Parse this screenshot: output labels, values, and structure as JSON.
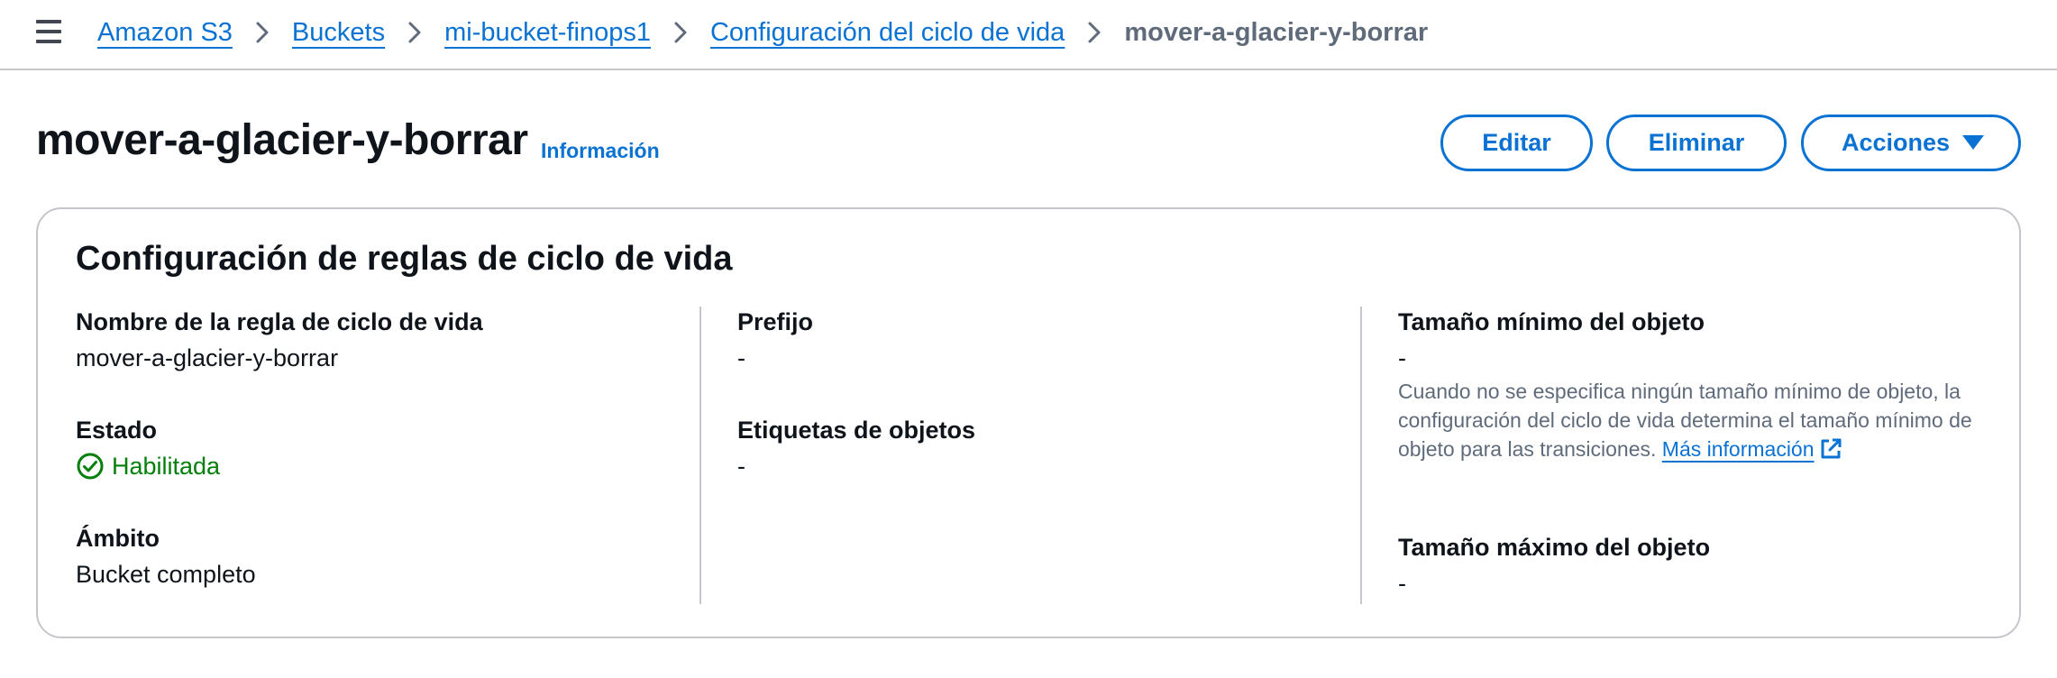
{
  "breadcrumb": {
    "items": [
      {
        "label": "Amazon S3"
      },
      {
        "label": "Buckets"
      },
      {
        "label": "mi-bucket-finops1"
      },
      {
        "label": "Configuración del ciclo de vida"
      }
    ],
    "current": "mover-a-glacier-y-borrar"
  },
  "header": {
    "title": "mover-a-glacier-y-borrar",
    "info_link": "Información",
    "buttons": {
      "edit": "Editar",
      "delete": "Eliminar",
      "actions": "Acciones"
    }
  },
  "card": {
    "title": "Configuración de reglas de ciclo de vida",
    "rule_name": {
      "label": "Nombre de la regla de ciclo de vida",
      "value": "mover-a-glacier-y-borrar"
    },
    "status": {
      "label": "Estado",
      "value": "Habilitada"
    },
    "scope": {
      "label": "Ámbito",
      "value": "Bucket completo"
    },
    "prefix": {
      "label": "Prefijo",
      "value": "-"
    },
    "tags": {
      "label": "Etiquetas de objetos",
      "value": "-"
    },
    "min_size": {
      "label": "Tamaño mínimo del objeto",
      "value": "-",
      "help": "Cuando no se especifica ningún tamaño mínimo de objeto, la configuración del ciclo de vida determina el tamaño mínimo de objeto para las transiciones.",
      "link": "Más información"
    },
    "max_size": {
      "label": "Tamaño máximo del objeto",
      "value": "-"
    }
  },
  "colors": {
    "link": "#0972d3",
    "success": "#037f0c",
    "text": "#0f141a",
    "muted": "#5f6b7a",
    "border": "#c6c6cd"
  },
  "icons": [
    "menu-icon",
    "chevron-right-icon",
    "caret-down-icon",
    "check-circle-icon",
    "external-link-icon"
  ]
}
